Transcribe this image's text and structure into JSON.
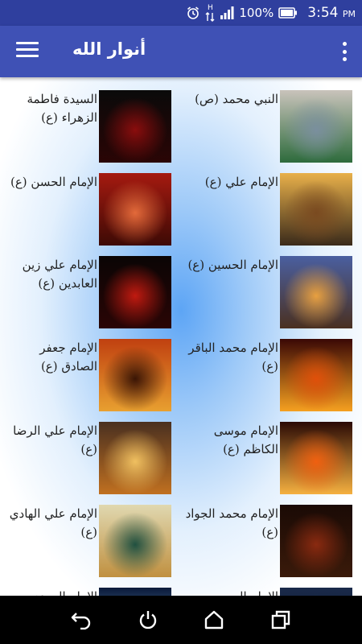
{
  "status_bar": {
    "battery_percent": "100%",
    "time": "3:54",
    "ampm": "PM",
    "network_label": "H",
    "icons": [
      "alarm-icon",
      "data-arrows-icon",
      "signal-icon",
      "battery-icon"
    ]
  },
  "app_bar": {
    "title": "أنوار الله",
    "menu_icon": "hamburger-menu-icon",
    "overflow_icon": "overflow-menu-icon"
  },
  "items": [
    {
      "label": "النبي محمد (ص)",
      "image": "mosque-green-dome-image",
      "colors": [
        "#c9c3bb",
        "#7a8f9e",
        "#2d6b3c"
      ]
    },
    {
      "label": "السيدة فاطمة الزهراء (ع)",
      "image": "red-calligraphy-image",
      "colors": [
        "#0a0a0a",
        "#8a0d0d",
        "#2a0505"
      ]
    },
    {
      "label": "الإمام علي (ع)",
      "image": "golden-shrine-image",
      "colors": [
        "#e8b04a",
        "#7a4a20",
        "#3a2a1a"
      ]
    },
    {
      "label": "الإمام الحسن (ع)",
      "image": "calligraphy-red-background-image",
      "colors": [
        "#a51a10",
        "#e36a3a",
        "#3d0a05"
      ]
    },
    {
      "label": "الإمام الحسين (ع)",
      "image": "shrine-at-dusk-image",
      "colors": [
        "#4a5fa0",
        "#e8a040",
        "#4a3020"
      ]
    },
    {
      "label": "الإمام علي زين العابدين (ع)",
      "image": "dark-red-calligraphy-image",
      "colors": [
        "#0a0505",
        "#c01a10",
        "#2a0505"
      ]
    },
    {
      "label": "الإمام محمد الباقر (ع)",
      "image": "fiery-sky-image",
      "colors": [
        "#3a0805",
        "#e0500a",
        "#f5a020"
      ]
    },
    {
      "label": "الإمام جعفر الصادق (ع)",
      "image": "orange-sky-calligraphy-image",
      "colors": [
        "#c04010",
        "#3a1505",
        "#e8a030"
      ]
    },
    {
      "label": "الإمام موسى الكاظم (ع)",
      "image": "mosque-sunset-image",
      "colors": [
        "#2a0a05",
        "#f06010",
        "#f5b040"
      ]
    },
    {
      "label": "الإمام علي الرضا (ع)",
      "image": "shrine-sunrays-image",
      "colors": [
        "#4a3020",
        "#f0c060",
        "#c07020"
      ]
    },
    {
      "label": "الإمام محمد الجواد (ع)",
      "image": "dark-calligraphy-candle-image",
      "colors": [
        "#1a0a05",
        "#8a2a10",
        "#3a1a0a"
      ]
    },
    {
      "label": "الإمام علي الهادي (ع)",
      "image": "shrine-frame-image",
      "colors": [
        "#e0d8b0",
        "#205040",
        "#c09040"
      ]
    },
    {
      "label": "الإمام الحسن",
      "image": "dark-sky-image",
      "colors": [
        "#1a2a4a",
        "#405a8a",
        "#0a1020"
      ]
    },
    {
      "label": "الإمام المهدي",
      "image": "blue-light-image",
      "colors": [
        "#0a1a3a",
        "#3060a0",
        "#90c0f0"
      ]
    }
  ],
  "nav_bar": {
    "back": "back-icon",
    "home": "home-icon",
    "power": "power-icon",
    "recents": "recents-icon"
  }
}
